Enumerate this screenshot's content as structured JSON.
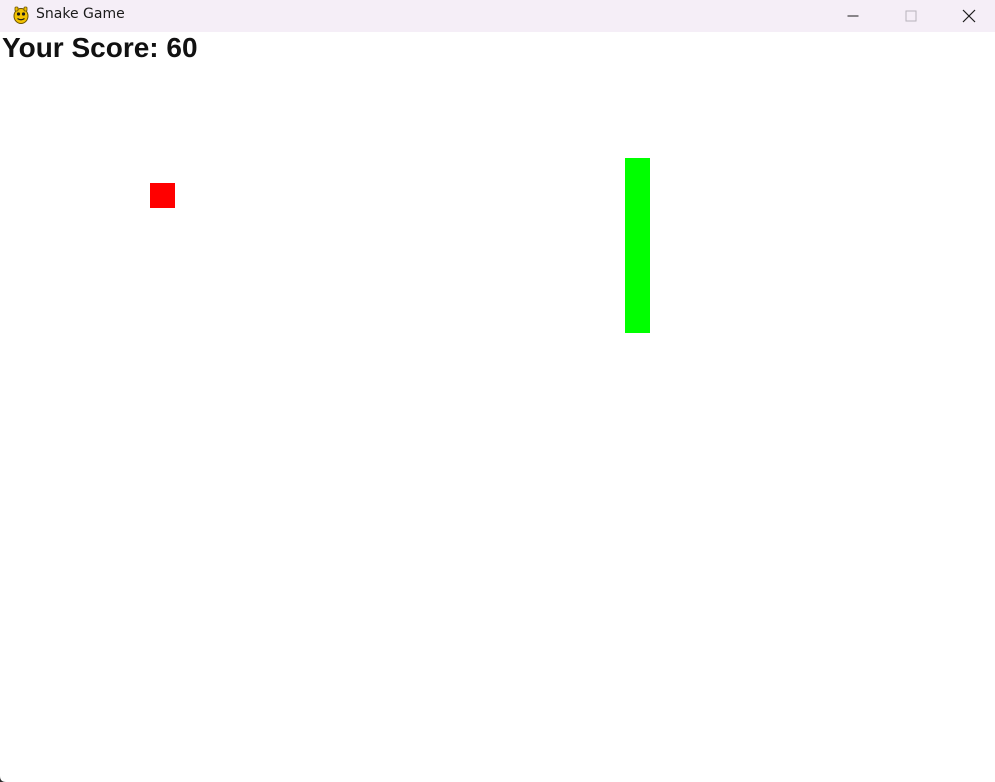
{
  "window": {
    "title": "Snake Game",
    "titlebar_color": "#f5eef7"
  },
  "controls": {
    "minimize_icon": "minimize-icon",
    "maximize_icon": "maximize-icon",
    "close_icon": "close-icon"
  },
  "game": {
    "score_text": "Your Score: 60",
    "score_color": "#111111",
    "background_color": "#ffffff",
    "food_color": "#ff0000",
    "snake_color": "#00ff00",
    "snake_length_segments": 7,
    "snake_direction": "vertical"
  }
}
